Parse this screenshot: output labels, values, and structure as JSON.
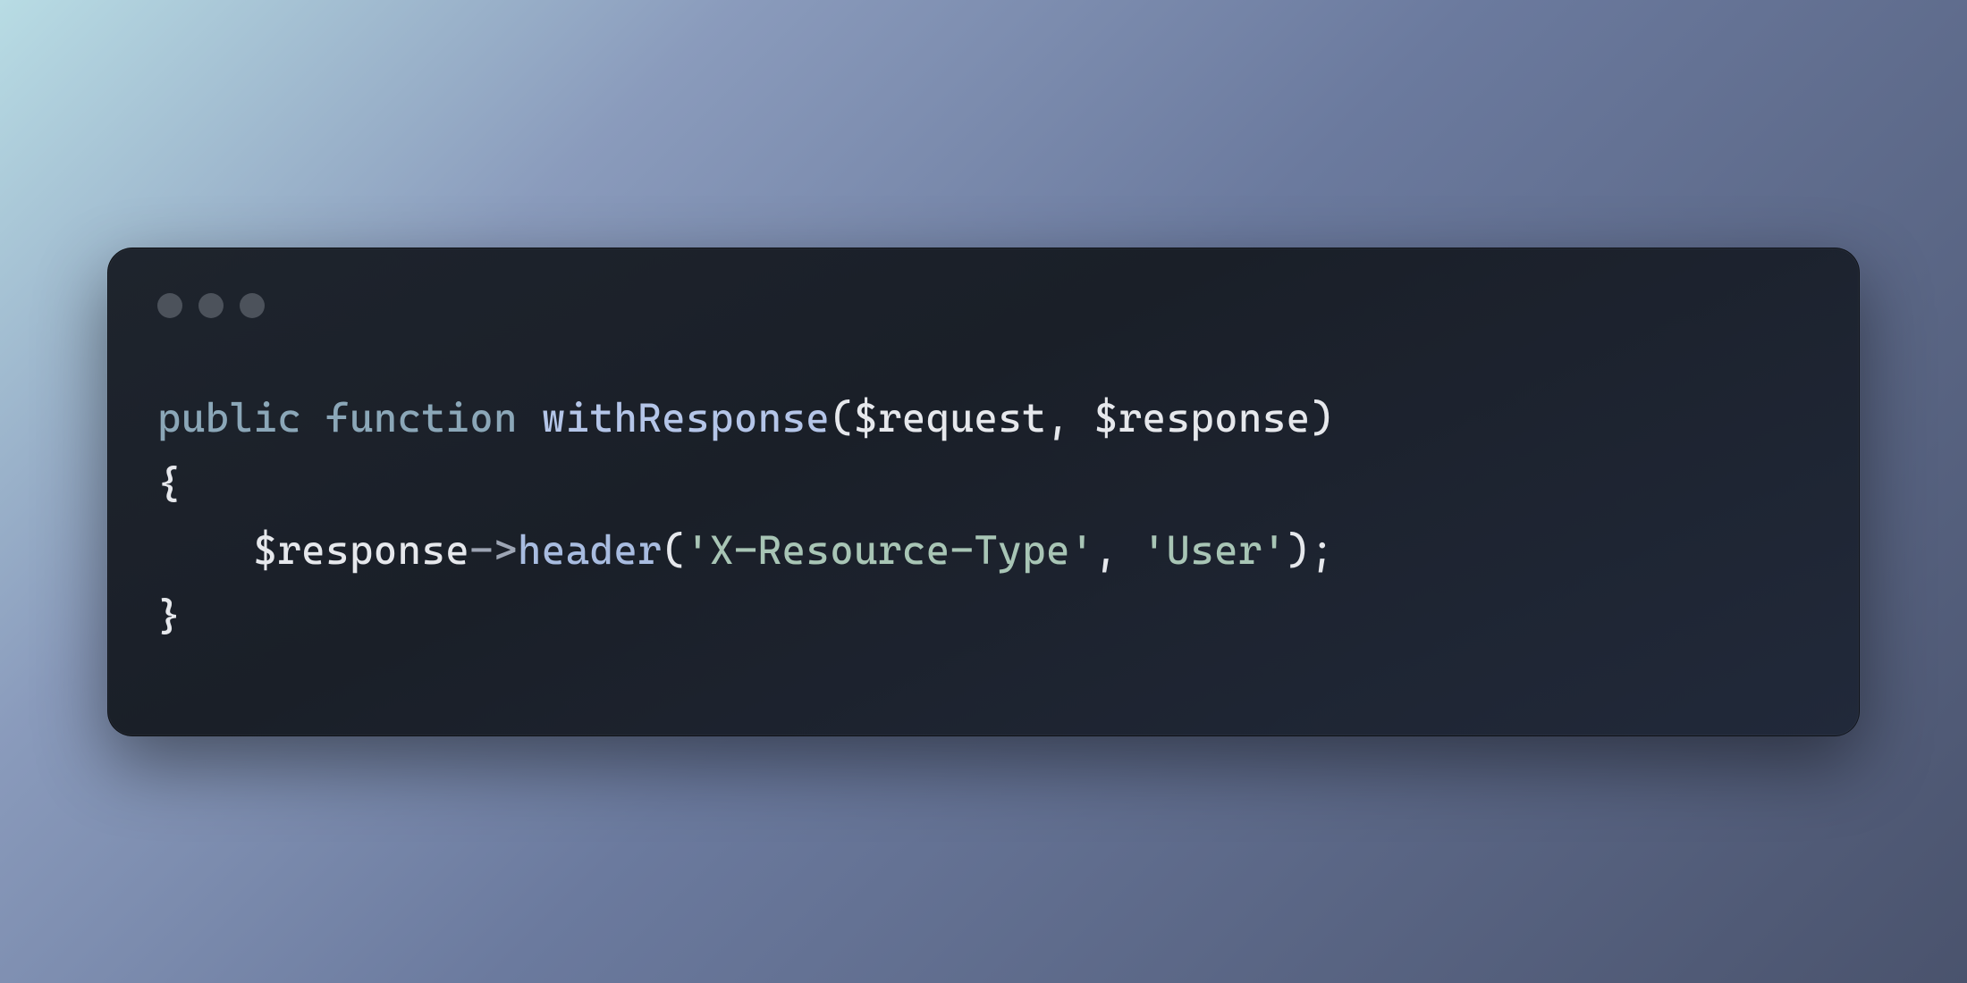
{
  "code": {
    "line1": {
      "kw_public": "public",
      "kw_function": "function",
      "name": "withResponse",
      "open_paren": "(",
      "param1": "$request",
      "comma": ", ",
      "param2": "$response",
      "close_paren": ")"
    },
    "line2": {
      "brace_open": "{"
    },
    "line3": {
      "indent": "    ",
      "var": "$response",
      "arrow": "->",
      "method": "header",
      "open_paren": "(",
      "arg1": "'X-Resource-Type'",
      "comma": ", ",
      "arg2": "'User'",
      "close_paren": ")",
      "semi": ";"
    },
    "line4": {
      "brace_close": "}"
    }
  },
  "colors": {
    "window_bg": "#1c212b",
    "keyword": "#8ba7b8",
    "funcname": "#b4c5e8",
    "method": "#a8bce0",
    "punct": "#e6e8ec",
    "string": "#a8c5b5",
    "traffic_light": "#4c525b"
  }
}
